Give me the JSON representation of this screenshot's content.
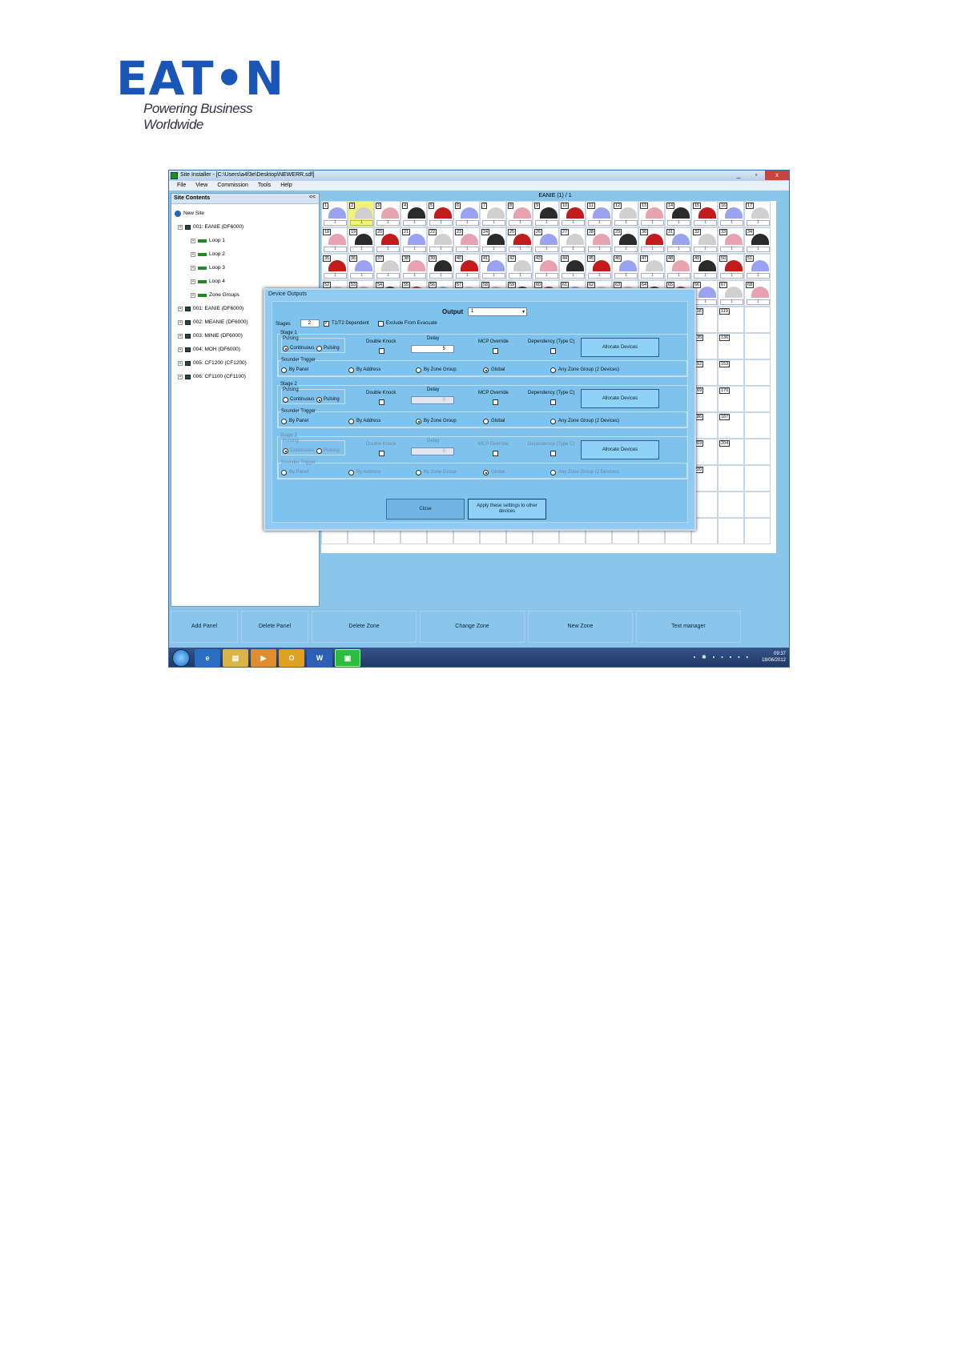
{
  "logo": {
    "word": "EAT•N",
    "tagline": "Powering Business Worldwide"
  },
  "window": {
    "title": "Site Installer - [C:\\Users\\a4f3e\\Desktop\\NEWERR.sdf]",
    "controls": {
      "minimize": "_",
      "maximize": "▫",
      "close": "x"
    },
    "menu": [
      "File",
      "View",
      "Commission",
      "Tools",
      "Help"
    ]
  },
  "sidebar": {
    "title": "Site Contents",
    "collapse": "<<",
    "tree": [
      {
        "label": "New Site",
        "level": 0,
        "icon": "site-icon"
      },
      {
        "label": "001: EANIE (DF6000)",
        "level": 1,
        "icon": "panel-icon"
      },
      {
        "label": "Loop 1",
        "level": 2,
        "icon": "loop-icon"
      },
      {
        "label": "Loop 2",
        "level": 2,
        "icon": "loop-icon"
      },
      {
        "label": "Loop 3",
        "level": 2,
        "icon": "loop-icon"
      },
      {
        "label": "Loop 4",
        "level": 2,
        "icon": "loop-icon"
      },
      {
        "label": "Zone Groups",
        "level": 2,
        "icon": "zone-groups-icon"
      },
      {
        "label": "001: EANIE (DF6000)",
        "level": 1,
        "icon": "panel-icon"
      },
      {
        "label": "002: MEANIE (DF6000)",
        "level": 1,
        "icon": "panel-icon"
      },
      {
        "label": "003: MINIE (DF6000)",
        "level": 1,
        "icon": "panel-icon"
      },
      {
        "label": "004: MOH (DF6000)",
        "level": 1,
        "icon": "panel-icon"
      },
      {
        "label": "005: CF1200 (CF1200)",
        "level": 1,
        "icon": "panel-icon"
      },
      {
        "label": "006: CF1100 (CF1100)",
        "level": 1,
        "icon": "panel-icon"
      }
    ]
  },
  "grid": {
    "title": "EANIE (1) / 1",
    "right_numbers": [
      "118",
      "119",
      "135",
      "136",
      "152",
      "153",
      "169",
      "170",
      "186",
      "187",
      "203",
      "204",
      "220"
    ]
  },
  "dialog": {
    "title": "Device Outputs",
    "output_label": "Output",
    "output_value": "1",
    "stages_label": "Stages",
    "stages_value": "2",
    "t1t2_label": "T1/T2 Dependent",
    "exclude_label": "Exclude From Evacuate",
    "pulsing_label": "Pulsing",
    "continuous_label": "Continuous",
    "pulsing_option": "Pulsing",
    "double_knock": "Double Knock",
    "delay": "Delay",
    "mcp_override": "MCP Override",
    "dependency": "Dependency (Type C)",
    "allocate": "Allocate Devices",
    "sounder_trigger": "Sounder Trigger",
    "by_panel": "By Panel",
    "by_address": "By Address",
    "by_zone_group": "By Zone Group",
    "global": "Global",
    "any_zone_group": "Any Zone Group (2 Devices)",
    "stage_titles": [
      "Stage 1",
      "Stage 2",
      "Stage 3"
    ],
    "delay_values": [
      "5",
      "0",
      "0"
    ],
    "close": "Close",
    "apply": "Apply these settings to other devices"
  },
  "bottom_buttons": [
    "Add Panel",
    "Delete Panel",
    "Delete Zone",
    "Change Zone",
    "New Zone",
    "Text manager"
  ],
  "taskbar": {
    "time": "09:37",
    "date": "18/06/2012"
  }
}
